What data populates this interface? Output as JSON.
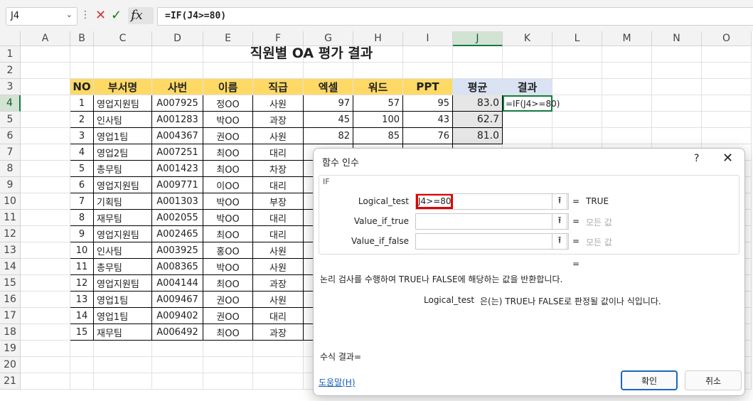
{
  "formula_bar": {
    "name_box": "J4",
    "formula": "=IF(J4>=80)",
    "fx_label": "fx"
  },
  "columns": [
    "A",
    "B",
    "C",
    "D",
    "E",
    "F",
    "G",
    "H",
    "I",
    "J",
    "K",
    "L",
    "M",
    "N",
    "O"
  ],
  "rows": [
    "1",
    "2",
    "3",
    "4",
    "5",
    "6",
    "7",
    "8",
    "9",
    "10",
    "11",
    "12",
    "13",
    "14",
    "15",
    "16",
    "17",
    "18",
    "19",
    "20",
    "21"
  ],
  "sheet": {
    "title": "직원별 OA 평가 결과",
    "headers": [
      "NO",
      "부서명",
      "사번",
      "이름",
      "직급",
      "엑셀",
      "워드",
      "PPT",
      "평균",
      "결과"
    ],
    "data": [
      [
        "1",
        "영업지원팀",
        "A007925",
        "정OO",
        "사원",
        "97",
        "57",
        "95",
        "83.0"
      ],
      [
        "2",
        "인사팀",
        "A001283",
        "박OO",
        "과장",
        "45",
        "100",
        "43",
        "62.7"
      ],
      [
        "3",
        "영업1팀",
        "A004367",
        "권OO",
        "사원",
        "82",
        "85",
        "76",
        "81.0"
      ],
      [
        "4",
        "영업2팀",
        "A007251",
        "최OO",
        "대리",
        "",
        "",
        "",
        ""
      ],
      [
        "5",
        "총무팀",
        "A001423",
        "최OO",
        "차장",
        "",
        "",
        "",
        ""
      ],
      [
        "6",
        "영업지원팀",
        "A009771",
        "이OO",
        "대리",
        "",
        "",
        "",
        ""
      ],
      [
        "7",
        "기획팀",
        "A001303",
        "박OO",
        "부장",
        "",
        "",
        "",
        ""
      ],
      [
        "8",
        "재무팀",
        "A002055",
        "박OO",
        "대리",
        "",
        "",
        "",
        ""
      ],
      [
        "9",
        "영업지원팀",
        "A002465",
        "최OO",
        "대리",
        "",
        "",
        "",
        ""
      ],
      [
        "10",
        "인사팀",
        "A003925",
        "홍OO",
        "사원",
        "",
        "",
        "",
        ""
      ],
      [
        "11",
        "총무팀",
        "A008365",
        "박OO",
        "사원",
        "",
        "",
        "",
        ""
      ],
      [
        "12",
        "영업지원팀",
        "A004144",
        "최OO",
        "과장",
        "",
        "",
        "",
        ""
      ],
      [
        "13",
        "영업1팀",
        "A009467",
        "권OO",
        "사원",
        "",
        "",
        "",
        ""
      ],
      [
        "14",
        "영업1팀",
        "A009402",
        "권OO",
        "대리",
        "",
        "",
        "",
        ""
      ],
      [
        "15",
        "재무팀",
        "A006492",
        "최OO",
        "과장",
        "",
        "",
        "",
        ""
      ]
    ],
    "active_cell_text": "=IF(J4>=80)"
  },
  "dialog": {
    "title": "함수 인수",
    "help_q": "?",
    "close": "✕",
    "function_name": "IF",
    "args": [
      {
        "label": "Logical_test",
        "value": "J4>=80",
        "result": "TRUE",
        "result_muted": false
      },
      {
        "label": "Value_if_true",
        "value": "",
        "result": "모든 값",
        "result_muted": true
      },
      {
        "label": "Value_if_false",
        "value": "",
        "result": "모든 값",
        "result_muted": true
      }
    ],
    "overall_eq": "=",
    "description": "논리 검사를 수행하여 TRUE나 FALSE에 해당하는 값을 반환합니다.",
    "arg_desc_name": "Logical_test",
    "arg_desc_text": "은(는) TRUE나 FALSE로 판정될 값이나 식입니다.",
    "formula_result": "수식 결과=",
    "help_link": "도움말(H)",
    "ok": "확인",
    "cancel": "취소"
  },
  "colors": {
    "header_yellow": "#ffd966",
    "header_blue": "#dae3f3",
    "average_gray": "#e7e6e6",
    "selection_green": "#107c41",
    "highlight_red": "#e00000"
  }
}
